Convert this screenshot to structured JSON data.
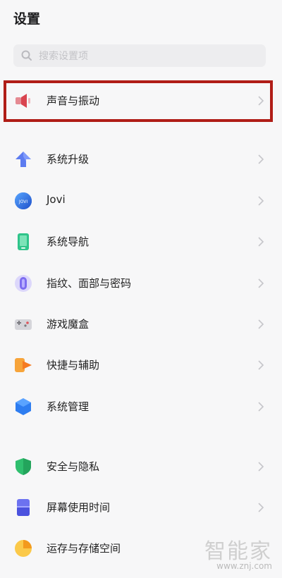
{
  "header": {
    "title": "设置"
  },
  "search": {
    "placeholder": "搜索设置项",
    "icon": "search-icon"
  },
  "settings": [
    {
      "label": "声音与振动",
      "icon": "speaker-icon",
      "highlighted": true
    },
    {
      "label": "系统升级",
      "icon": "upgrade-arrow-icon"
    },
    {
      "label": "Jovi",
      "icon": "jovi-icon"
    },
    {
      "label": "系统导航",
      "icon": "navigation-phone-icon"
    },
    {
      "label": "指纹、面部与密码",
      "icon": "fingerprint-icon"
    },
    {
      "label": "游戏魔盒",
      "icon": "game-box-icon"
    },
    {
      "label": "快捷与辅助",
      "icon": "shortcut-icon"
    },
    {
      "label": "系统管理",
      "icon": "system-management-icon"
    },
    {
      "label": "安全与隐私",
      "icon": "shield-icon"
    },
    {
      "label": "屏幕使用时间",
      "icon": "screen-time-icon"
    },
    {
      "label": "运存与存储空间",
      "icon": "storage-pie-icon"
    }
  ],
  "watermark": {
    "brand": "智能家",
    "url": "www.znj.com"
  },
  "colors": {
    "highlight": "#b01d17",
    "background": "#f7f7f8"
  }
}
